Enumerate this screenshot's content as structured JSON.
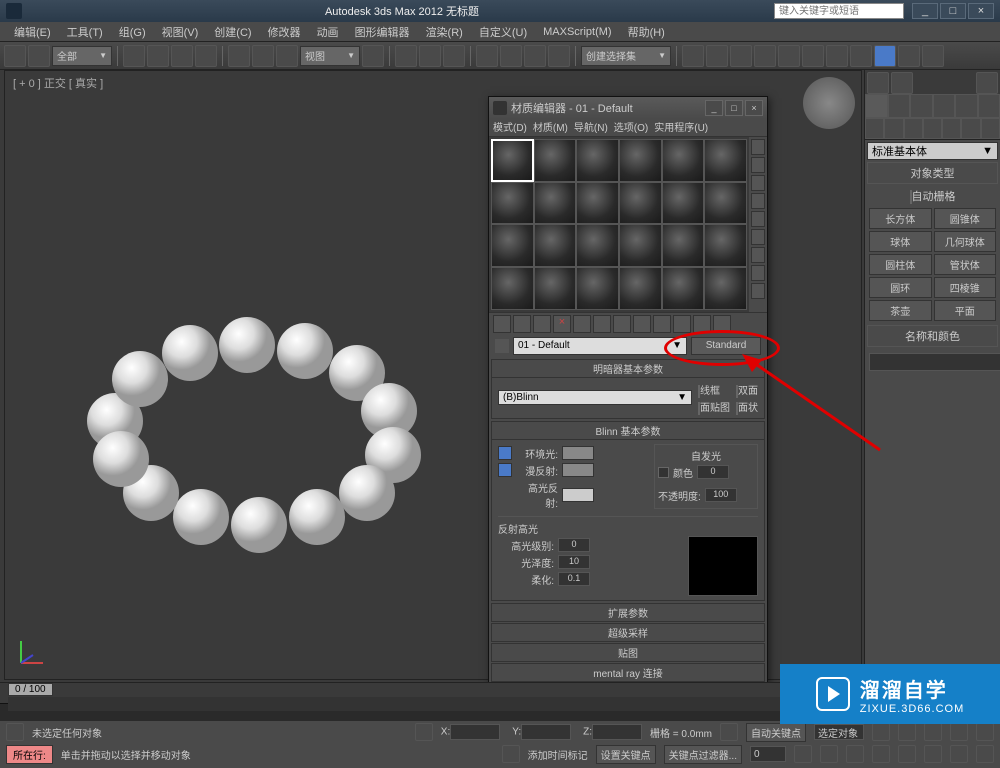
{
  "app": {
    "title": "Autodesk 3ds Max 2012    无标题",
    "search_placeholder": "键入关键字或短语"
  },
  "menus": [
    "编辑(E)",
    "工具(T)",
    "组(G)",
    "视图(V)",
    "创建(C)",
    "修改器",
    "动画",
    "图形编辑器",
    "渲染(R)",
    "自定义(U)",
    "MAXScript(M)",
    "帮助(H)"
  ],
  "toolbar": {
    "dropdown1": "全部",
    "dropdown2": "视图",
    "dropdown3": "创建选择集"
  },
  "viewport": {
    "label": "[ + 0 ] 正交 [ 真实 ]"
  },
  "cmdpanel": {
    "dropdown": "标准基本体",
    "rollout1": "对象类型",
    "autogrid": "自动栅格",
    "buttons": [
      "长方体",
      "圆锥体",
      "球体",
      "几何球体",
      "圆柱体",
      "管状体",
      "圆环",
      "四棱锥",
      "茶壶",
      "平面"
    ],
    "rollout2": "名称和颜色"
  },
  "material_editor": {
    "title": "材质编辑器 - 01 - Default",
    "menus": [
      "模式(D)",
      "材质(M)",
      "导航(N)",
      "选项(O)",
      "实用程序(U)"
    ],
    "material_name": "01 - Default",
    "material_type": "Standard",
    "rollout_shader": "明暗器基本参数",
    "shader": "(B)Blinn",
    "opt_wire": "线框",
    "opt_2sided": "双面",
    "opt_facemap": "面贴图",
    "opt_faceted": "面状",
    "rollout_blinn": "Blinn 基本参数",
    "selfillum": "自发光",
    "color_label": "颜色",
    "selfillum_val": "0",
    "ambient": "环境光:",
    "diffuse": "漫反射:",
    "specular": "高光反射:",
    "opacity": "不透明度:",
    "opacity_val": "100",
    "spec_hl": "反射高光",
    "spec_level": "高光级别:",
    "spec_level_val": "0",
    "gloss": "光泽度:",
    "gloss_val": "10",
    "soften": "柔化:",
    "soften_val": "0.1",
    "closed_rollouts": [
      "扩展参数",
      "超级采样",
      "贴图",
      "mental ray 连接"
    ]
  },
  "timeline": {
    "slider": "0 / 100"
  },
  "status": {
    "nosel": "未选定任何对象",
    "hint": "单击并拖动以选择并移动对象",
    "addtime_label": "添加时间标记",
    "x": "X:",
    "y": "Y:",
    "z": "Z:",
    "grid": "栅格 = 0.0mm",
    "autokey": "自动关键点",
    "selset": "选定对象",
    "setkey": "设置关键点",
    "keyfilter": "关键点过滤器...",
    "allbtn": "所在行:"
  },
  "watermark": {
    "cn": "溜溜自学",
    "en": "ZIXUE.3D66.COM"
  }
}
